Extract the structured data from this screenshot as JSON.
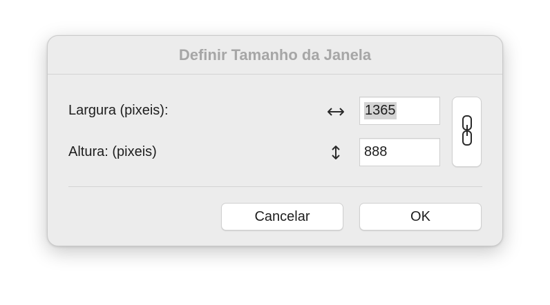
{
  "dialog": {
    "title": "Definir Tamanho da Janela",
    "width_row": {
      "label": "Largura (pixeis):",
      "icon": "horizontal-arrows-icon",
      "value": "1365",
      "value_selected": true
    },
    "height_row": {
      "label": "Altura: (pixeis)",
      "icon": "vertical-arrows-icon",
      "value": "888"
    },
    "link_button": {
      "icon": "chain-link-icon"
    },
    "buttons": {
      "cancel_label": "Cancelar",
      "ok_label": "OK"
    }
  },
  "colors": {
    "dialog_bg": "#ececec",
    "title_text": "#a6a6a6",
    "text": "#1d1d1d",
    "selection": "#d4d4d4"
  }
}
